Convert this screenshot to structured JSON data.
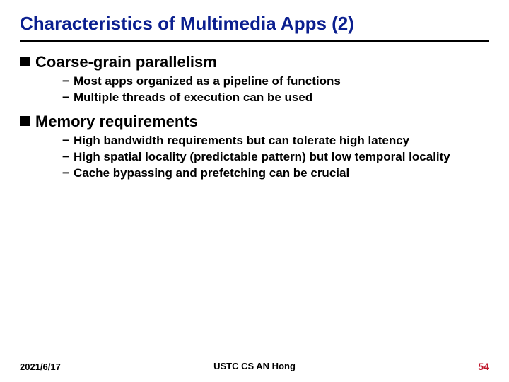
{
  "title": "Characteristics of Multimedia Apps (2)",
  "bullets": [
    {
      "label": "Coarse-grain parallelism",
      "sub": [
        "Most apps organized as a pipeline of functions",
        "Multiple threads of execution can be used"
      ]
    },
    {
      "label": "Memory requirements",
      "sub": [
        "High bandwidth requirements but can tolerate high latency",
        "High spatial locality (predictable pattern) but low temporal locality",
        "Cache bypassing and prefetching can be crucial"
      ]
    }
  ],
  "footer": {
    "date": "2021/6/17",
    "center": "USTC CS AN Hong",
    "page": "54"
  }
}
